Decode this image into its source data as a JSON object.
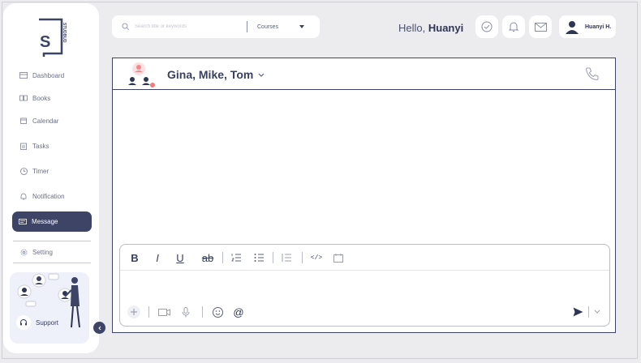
{
  "sidebar": {
    "logo_text": "S",
    "logo_brand": "STUDBUD",
    "items": [
      {
        "label": "Dashboard",
        "icon": "dashboard-icon"
      },
      {
        "label": "Books",
        "icon": "book-icon"
      },
      {
        "label": "Calendar",
        "icon": "calendar-icon"
      },
      {
        "label": "Tasks",
        "icon": "tasks-icon"
      },
      {
        "label": "Timer",
        "icon": "clock-icon"
      },
      {
        "label": "Notification",
        "icon": "bell-icon"
      },
      {
        "label": "Message",
        "icon": "message-icon",
        "active": true
      },
      {
        "label": "Setting",
        "icon": "gear-icon"
      }
    ],
    "support_label": "Support"
  },
  "topbar": {
    "search_placeholder": "Search title or keywords",
    "filter_value": "Courses",
    "greeting_prefix": "Hello,",
    "greeting_name": "Huanyi",
    "user_name": "Huanyi H."
  },
  "chat": {
    "title": "Gina, Mike, Tom",
    "toolbar": {
      "bold": "B",
      "italic": "I",
      "underline": "U",
      "strike": "ab",
      "code": "</>"
    },
    "mention": "@"
  },
  "colors": {
    "accent": "#3d4466",
    "status_dot": "#f27a7a",
    "background": "#ececee"
  }
}
